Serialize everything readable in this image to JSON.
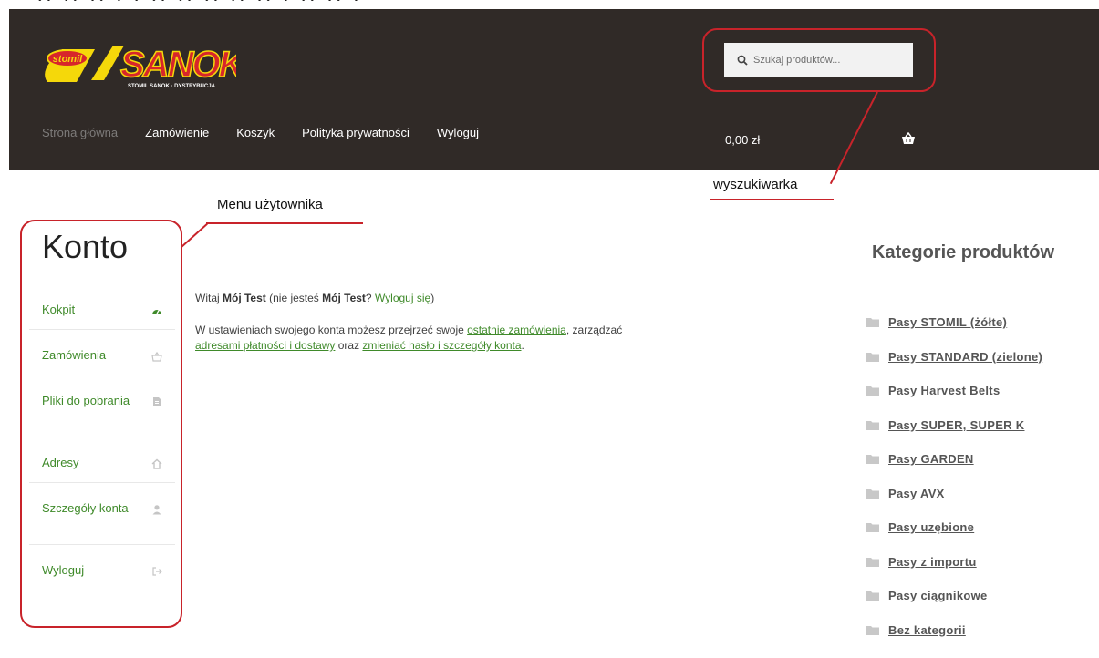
{
  "search": {
    "placeholder": "Szukaj produktów..."
  },
  "nav": {
    "items": [
      "Strona główna",
      "Zamówienie",
      "Koszyk",
      "Polityka prywatności",
      "Wyloguj"
    ]
  },
  "cart": {
    "total": "0,00 zł"
  },
  "annotations": {
    "search_label": "wyszukiwarka",
    "menu_label": "Menu użytownika"
  },
  "account": {
    "title": "Konto",
    "menu": [
      {
        "label": "Kokpit",
        "icon": "dashboard-icon"
      },
      {
        "label": "Zamówienia",
        "icon": "basket-icon"
      },
      {
        "label": "Pliki do pobrania",
        "icon": "file-icon"
      },
      {
        "label": "Adresy",
        "icon": "home-icon"
      },
      {
        "label": "Szczegóły konta",
        "icon": "user-icon"
      },
      {
        "label": "Wyloguj",
        "icon": "sign-out-icon"
      }
    ]
  },
  "main": {
    "greeting_prefix": "Witaj ",
    "user_name": "Mój Test",
    "greeting_middle": " (nie jesteś ",
    "user_name_2": "Mój Test",
    "greeting_q": "? ",
    "logout_link": "Wyloguj się",
    "greeting_end": ")",
    "text_1": "W ustawieniach swojego konta możesz przejrzeć swoje ",
    "link_orders": "ostatnie zamówienia",
    "text_2": ", zarządzać ",
    "link_addresses": "adresami płatności i dostawy",
    "text_3": " oraz ",
    "link_account": "zmieniać hasło i szczegóły konta",
    "text_4": "."
  },
  "sidebar": {
    "title": "Kategorie produktów",
    "categories": [
      "Pasy STOMIL (żółte)",
      "Pasy STANDARD (zielone)",
      "Pasy Harvest Belts",
      "Pasy SUPER, SUPER K",
      "Pasy GARDEN",
      "Pasy AVX",
      "Pasy uzębione",
      "Pasy z importu",
      "Pasy ciągnikowe",
      "Bez kategorii"
    ]
  },
  "logo": {
    "brand": "SANOK",
    "badge": "stomil",
    "tagline": "STOMIL SANOK · DYSTRYBUCJA"
  },
  "colors": {
    "header_bg": "#302a27",
    "link_green": "#3f8a2a",
    "annotation_red": "#c8232a",
    "logo_yellow": "#f5d80a",
    "logo_red": "#d7262b"
  }
}
